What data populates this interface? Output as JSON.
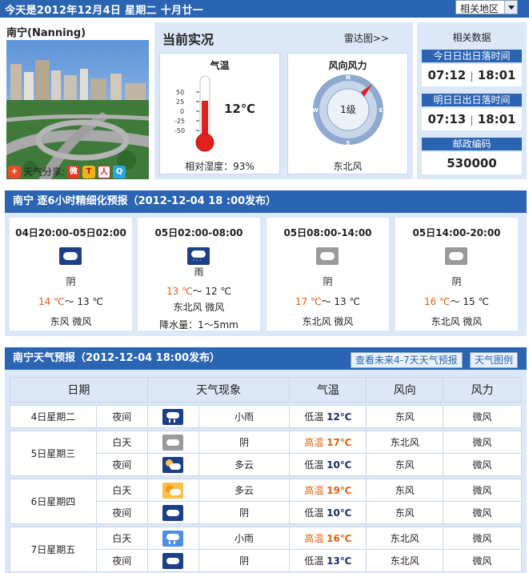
{
  "top": {
    "title": "今天是2012年12月4日 星期二 十月廿一",
    "region_select": "相关地区"
  },
  "city": {
    "name": "南宁(Nanning)",
    "share_label": "天气分享:"
  },
  "current": {
    "heading": "当前实况",
    "radar_link": "雷达图>>",
    "temp_label": "气温",
    "temp_value": "12℃",
    "scale": [
      "50",
      "25",
      "0",
      "-25",
      "-50"
    ],
    "temp_fill_fraction": 0.62,
    "humidity": "相对湿度：93%",
    "wind_label": "风向风力",
    "wind_level": "1级",
    "wind_dir": "东北风",
    "compass": {
      "n": "N",
      "e": "E",
      "s": "S",
      "w": "W"
    }
  },
  "related": {
    "heading": "相关数据",
    "today_title": "今日日出日落时间",
    "today_rise": "07:12",
    "today_set": "18:01",
    "tomorrow_title": "明日日出日落时间",
    "tomorrow_rise": "07:13",
    "tomorrow_set": "18:01",
    "zip_title": "邮政编码",
    "zip": "530000"
  },
  "six_hour": {
    "title": "南宁  逐6小时精细化预报（2012-12-04   18 :00发布）",
    "periods": [
      {
        "time": "04日20:00-05日02:00",
        "weather": "阴",
        "icon": "overcast-night-icon",
        "high": "14 ℃",
        "low": "13 ℃",
        "wind": "东风  微风",
        "rain": ""
      },
      {
        "time": "05日02:00-08:00",
        "weather": "雨",
        "icon": "rain-icon",
        "high": "13 ℃",
        "low": "12 ℃",
        "wind": "东北风  微风",
        "rain": "降水量：1～5mm"
      },
      {
        "time": "05日08:00-14:00",
        "weather": "阴",
        "icon": "overcast-icon",
        "high": "17 ℃",
        "low": "13 ℃",
        "wind": "东北风  微风",
        "rain": ""
      },
      {
        "time": "05日14:00-20:00",
        "weather": "阴",
        "icon": "overcast-icon",
        "high": "16 ℃",
        "low": "15 ℃",
        "wind": "东北风  微风",
        "rain": ""
      }
    ]
  },
  "forecast": {
    "title": "南宁天气预报（2012-12-04   18:00发布）",
    "btn_more": "查看未来4-7天天气预报",
    "btn_legend": "天气图例",
    "headers": [
      "日期",
      "天气现象",
      "气温",
      "风向",
      "风力"
    ],
    "rows": [
      {
        "date": "4日星期二",
        "part": "夜间",
        "icon": "light-rain-night-icon",
        "weather": "小雨",
        "tlabel": "低温",
        "temp": "12℃",
        "dir": "东风",
        "force": "微风"
      },
      {
        "date": "5日星期三",
        "part": "白天",
        "icon": "overcast-icon",
        "weather": "阴",
        "tlabel": "高温",
        "temp": "17℃",
        "dir": "东北风",
        "force": "微风"
      },
      {
        "date": "",
        "part": "夜间",
        "icon": "partly-cloudy-night-icon",
        "weather": "多云",
        "tlabel": "低温",
        "temp": "10℃",
        "dir": "东风",
        "force": "微风"
      },
      {
        "date": "6日星期四",
        "part": "白天",
        "icon": "partly-cloudy-day-icon",
        "weather": "多云",
        "tlabel": "高温",
        "temp": "19℃",
        "dir": "东风",
        "force": "微风"
      },
      {
        "date": "",
        "part": "夜间",
        "icon": "overcast-night-icon",
        "weather": "阴",
        "tlabel": "低温",
        "temp": "10℃",
        "dir": "东风",
        "force": "微风"
      },
      {
        "date": "7日星期五",
        "part": "白天",
        "icon": "light-rain-icon",
        "weather": "小雨",
        "tlabel": "高温",
        "temp": "16℃",
        "dir": "东北风",
        "force": "微风"
      },
      {
        "date": "",
        "part": "夜间",
        "icon": "overcast-night-icon",
        "weather": "阴",
        "tlabel": "低温",
        "temp": "13℃",
        "dir": "东北风",
        "force": "微风"
      }
    ]
  },
  "colors": {
    "brand_blue": "#2b64b3",
    "light_blue": "#dce8f7",
    "high_temp": "#e0600e",
    "low_temp": "#1a2a6a"
  }
}
